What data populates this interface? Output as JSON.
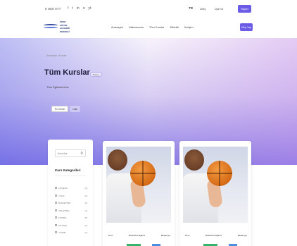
{
  "topbar": {
    "phone": "0 850 077",
    "social_icons": [
      "f",
      "t",
      "in",
      "o",
      "yt"
    ],
    "language": "TR",
    "login_label": "Giriş",
    "signup_label": "Üye Ol",
    "cart_label": "Sepet"
  },
  "logo": {
    "lines": [
      "SPOR",
      "EĞİTİM",
      "AKADEMİ",
      "DERNEĞİ"
    ]
  },
  "nav": {
    "items": [
      "Anasayfa",
      "Hakkımızda",
      "Tüm Kurslar",
      "Etkinlik",
      "İletişim"
    ],
    "cta_label": "Giriş Yap"
  },
  "hero": {
    "breadcrumb": "Anasayfa / Kurslar",
    "title": "Tüm Kurslar",
    "count_label": "8 Kurs",
    "subtitle": "Tüm Eğitimlerimiz",
    "filter_active": "En Yeniler",
    "filter_inactive": "Liste"
  },
  "sidebar": {
    "search_placeholder": "Kurs Ara",
    "search_icon": "search-icon",
    "categories_title": "Kurs Kategorileri",
    "categories": [
      {
        "label": "FITNESS",
        "count": "(3)"
      },
      {
        "label": "YOGA",
        "count": "(2)"
      },
      {
        "label": "BASKETBOL",
        "count": "(4)"
      },
      {
        "label": "VOLEYBOL",
        "count": "(1)"
      },
      {
        "label": "FUTBOL",
        "count": "(5)"
      },
      {
        "label": "PILATES",
        "count": "(2)"
      },
      {
        "label": "YÜZME",
        "count": "(3)"
      }
    ]
  },
  "cards": [
    {
      "author": "Ders",
      "duration": "Basketbol Eğitimi",
      "level": "Başlangıç"
    },
    {
      "author": "Ders",
      "duration": "Basketbol Eğitimi",
      "level": "Başlangıç"
    }
  ],
  "colors": {
    "accent": "#6b5ce7",
    "tag_green": "#37b36a",
    "tag_blue": "#4a8fe0"
  }
}
